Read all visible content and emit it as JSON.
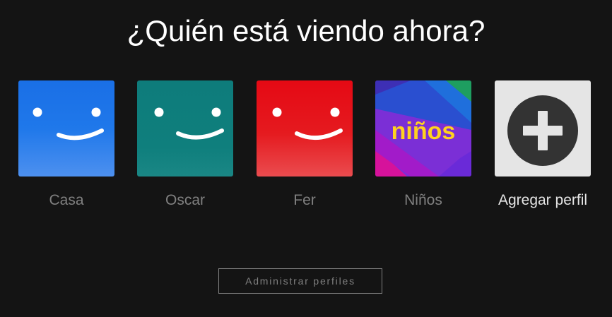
{
  "header": {
    "title": "¿Quién está viendo ahora?"
  },
  "profiles": [
    {
      "name": "Casa",
      "avatar": "smiley-face-blue",
      "color": "#1f78ea"
    },
    {
      "name": "Oscar",
      "avatar": "smiley-face-teal",
      "color": "#0f7f7d"
    },
    {
      "name": "Fer",
      "avatar": "smiley-face-red",
      "color": "#e50914"
    },
    {
      "name": "Niños",
      "avatar": "kids-logo",
      "logo_text": "niños",
      "color": "#7b2fd6"
    },
    {
      "name": "Agregar perfil",
      "avatar": "plus-circle-icon",
      "color": "#e5e5e5"
    }
  ],
  "footer": {
    "manage_label": "Administrar perfiles"
  },
  "colors": {
    "background": "#141414",
    "title": "#ffffff",
    "profile_name": "#808080",
    "add_profile_name": "#e5e5e5",
    "kids_logo": "#ffd21f"
  }
}
